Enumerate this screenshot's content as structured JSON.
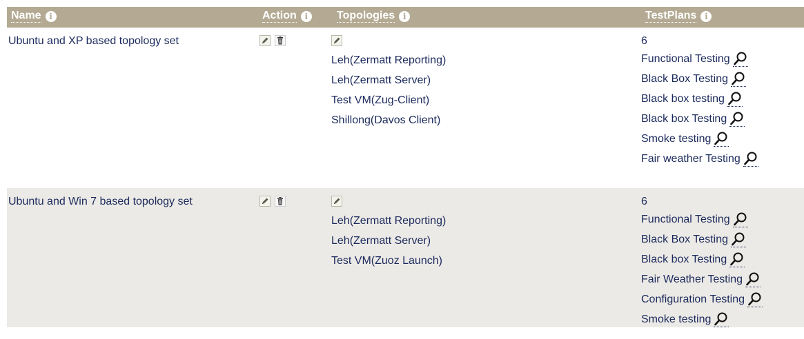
{
  "table": {
    "headers": {
      "name": "Name",
      "action": "Action",
      "topologies": "Topologies",
      "testplans": "TestPlans"
    },
    "rows": [
      {
        "name": "Ubuntu and XP based topology set",
        "topologies": [
          "Leh(Zermatt Reporting)",
          "Leh(Zermatt Server)",
          "Test VM(Zug-Client)",
          "Shillong(Davos Client)"
        ],
        "testplan_count": "6",
        "testplans": [
          "Functional Testing",
          "Black Box Testing",
          "Black box testing",
          "Black box Testing",
          "Smoke testing",
          "Fair weather Testing"
        ]
      },
      {
        "name": "Ubuntu and Win 7 based topology set",
        "topologies": [
          "Leh(Zermatt Reporting)",
          "Leh(Zermatt Server)",
          "Test VM(Zuoz Launch)"
        ],
        "testplan_count": "6",
        "testplans": [
          "Functional Testing",
          "Black Box Testing",
          "Black box Testing",
          "Fair Weather Testing",
          "Configuration Testing",
          "Smoke testing"
        ]
      }
    ]
  },
  "icons": {
    "info": "info-icon",
    "edit": "edit-icon",
    "delete": "trash-icon",
    "view": "magnifier-icon"
  },
  "colors": {
    "header_bg": "#b4aa93",
    "alt_row_bg": "#eceae6",
    "text": "#1b2a5c"
  }
}
